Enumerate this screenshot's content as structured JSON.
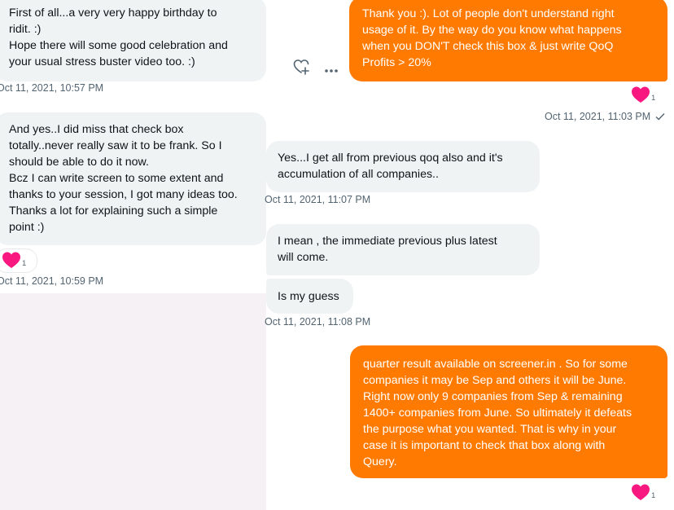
{
  "colors": {
    "incoming_bubble": "#eff3f4",
    "outgoing_bubble": "#ff7a00",
    "heart": "#f91880",
    "timestamp": "#536471"
  },
  "messages": [
    {
      "side": "incoming",
      "lines": [
        "First of all...a very very happy birthday to",
        "ridit. :)",
        "Hope there will some good celebration and",
        "your usual stress buster video too. :)"
      ],
      "time": "Oct 11, 2021, 10:57 PM"
    },
    {
      "side": "outgoing",
      "lines": [
        "Thank you :). Lot of people don't understand right",
        "usage of it.  By the way do you know what happens",
        "when you DON'T check this box & just write QoQ",
        "Profits > 20%"
      ],
      "reaction_count": "1",
      "time": "Oct 11, 2021, 11:03 PM",
      "status_icon": "check-icon"
    },
    {
      "side": "incoming",
      "lines": [
        "And yes..I did miss that check box",
        "totally..never really saw it to be frank. So I",
        "should be able to do it now.",
        "Bcz I can write screen to some extent and",
        "thanks to your session, I got many ideas too.",
        "Thanks a lot for explaining such a simple",
        "point :)"
      ],
      "reaction_count": "1",
      "time": "Oct 11, 2021, 10:59 PM"
    },
    {
      "side": "incoming",
      "lines": [
        "Yes...I get all from previous qoq also and it's",
        "accumulation of all companies.."
      ],
      "time": "Oct 11, 2021, 11:07 PM"
    },
    {
      "side": "incoming",
      "lines": [
        "I mean , the immediate previous plus latest",
        "will come."
      ]
    },
    {
      "side": "incoming",
      "lines": [
        "Is my guess"
      ],
      "time": "Oct 11, 2021, 11:08 PM"
    },
    {
      "side": "outgoing",
      "lines": [
        "quarter result available on screener.in . So for some",
        "companies it may be Sep and others it will be June.",
        "Right now only 9 companies from Sep & remaining",
        "1400+ companies from June. So ultimately it defeats",
        "the purpose what you wanted. That is why in your",
        "case it is important to check that box along with",
        "Query."
      ],
      "reaction_count": "1"
    }
  ],
  "actions": {
    "react_icon": "heart-plus-icon",
    "more_icon": "more-icon"
  }
}
